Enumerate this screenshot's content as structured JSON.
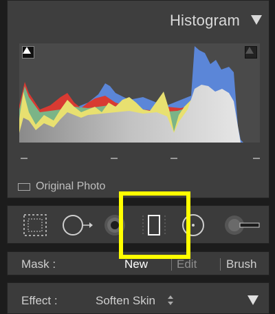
{
  "histogram": {
    "title": "Histogram",
    "original_photo_label": "Original Photo"
  },
  "mask": {
    "label": "Mask :",
    "new": "New",
    "edit": "Edit",
    "brush": "Brush"
  },
  "effect": {
    "label": "Effect :",
    "value": "Soften Skin"
  },
  "tools": [
    "crop-overlay-icon",
    "spot-removal-icon",
    "red-eye-icon",
    "graduated-filter-icon",
    "radial-filter-icon",
    "adjustment-brush-icon"
  ],
  "colors": {
    "panel": "#3e3e3e",
    "background": "#1c1c1c",
    "highlight": "#ffff00",
    "hist_gray": "#c8c8c8",
    "hist_yellow": "#e8e070",
    "hist_blue": "#5b86d8",
    "hist_red": "#d83a32"
  }
}
